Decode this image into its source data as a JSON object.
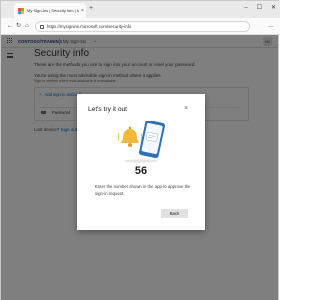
{
  "browser": {
    "tab_title": "My Sign-Ins | Security Info | Micr...",
    "tab_close": "×",
    "new_tab": "+",
    "url": "https://mysignins.microsoft.com/security-info",
    "window_controls": [
      "–",
      "☐",
      "✕"
    ],
    "menu": "…"
  },
  "header": {
    "brand": "CONTOSO/TRAINING",
    "app_name": "My Sign-Ins",
    "avatar_initials": "HC"
  },
  "page": {
    "title": "Security info",
    "subtitle": "These are the methods you use to sign into your account or reset your password.",
    "default_note": "You're using the most advisable sign-in method where it applies.",
    "default_sub": "Sign-in method when most advisable is unavailable:",
    "add_method": "Add sign-in method",
    "method_row": "Password",
    "lost_device": "Lost device?",
    "lost_device_link": "Sign out everywhere"
  },
  "dialog": {
    "title": "Let's try it out",
    "code": "56",
    "instruction": "Enter the number shown in the app to approve the sign-in request.",
    "back_label": "Back"
  },
  "colors": {
    "ms_red": "#f25022",
    "ms_green": "#7fba00",
    "ms_blue": "#00a4ef",
    "ms_yellow": "#ffb900",
    "link": "#0067b8",
    "bell": "#f2b83a",
    "phone": "#2f6fb5"
  }
}
